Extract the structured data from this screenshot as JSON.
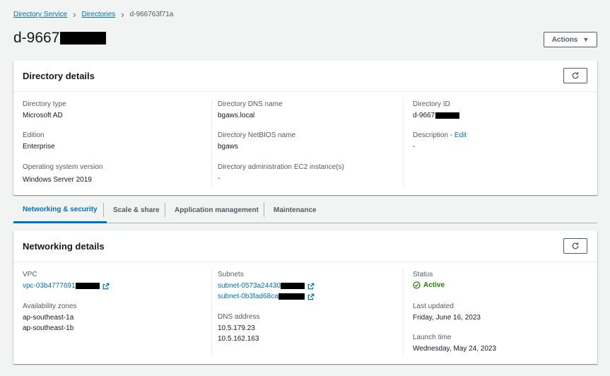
{
  "breadcrumb": {
    "items": [
      "Directory Service",
      "Directories"
    ],
    "current": "d-966763f71a"
  },
  "page": {
    "title_prefix": "d-9667",
    "actions_label": "Actions"
  },
  "directory_details": {
    "title": "Directory details",
    "col1": [
      {
        "label": "Directory type",
        "value": "Microsoft AD"
      },
      {
        "label": "Edition",
        "value": "Enterprise"
      },
      {
        "label": "Operating system version",
        "value": "Windows Server 2019"
      }
    ],
    "col2": [
      {
        "label": "Directory DNS name",
        "value": "bgaws.local"
      },
      {
        "label": "Directory NetBIOS name",
        "value": "bgaws"
      },
      {
        "label": "Directory administration EC2 instance(s)",
        "value": "-"
      }
    ],
    "col3": {
      "directory_id_label": "Directory ID",
      "directory_id_prefix": "d-9667",
      "description_label": "Description - ",
      "edit_label": "Edit",
      "description_value": "-"
    }
  },
  "tabs": [
    {
      "label": "Networking & security",
      "active": true
    },
    {
      "label": "Scale & share",
      "active": false
    },
    {
      "label": "Application management",
      "active": false
    },
    {
      "label": "Maintenance",
      "active": false
    }
  ],
  "networking_details": {
    "title": "Networking details",
    "vpc_label": "VPC",
    "vpc_prefix": "vpc-03b4777691",
    "az_label": "Availability zones",
    "az_values": [
      "ap-southeast-1a",
      "ap-southeast-1b"
    ],
    "subnets_label": "Subnets",
    "subnets": [
      "subnet-0573a24430",
      "subnet-0b3fad68ca"
    ],
    "dns_label": "DNS address",
    "dns_values": [
      "10.5.179.23",
      "10.5.162.163"
    ],
    "status_label": "Status",
    "status_value": "Active",
    "last_updated_label": "Last updated",
    "last_updated_value": "Friday, June 16, 2023",
    "launch_time_label": "Launch time",
    "launch_time_value": "Wednesday, May 24, 2023"
  },
  "colors": {
    "link": "#0073bb",
    "success": "#1d8102",
    "text": "#16191f",
    "label": "#545b64",
    "background": "#f2f3f3"
  },
  "icons": {
    "refresh": "refresh-icon",
    "external": "external-link-icon",
    "status": "check-circle-icon",
    "caret": "caret-down-icon",
    "breadcrumb_sep": "chevron-right-icon"
  }
}
